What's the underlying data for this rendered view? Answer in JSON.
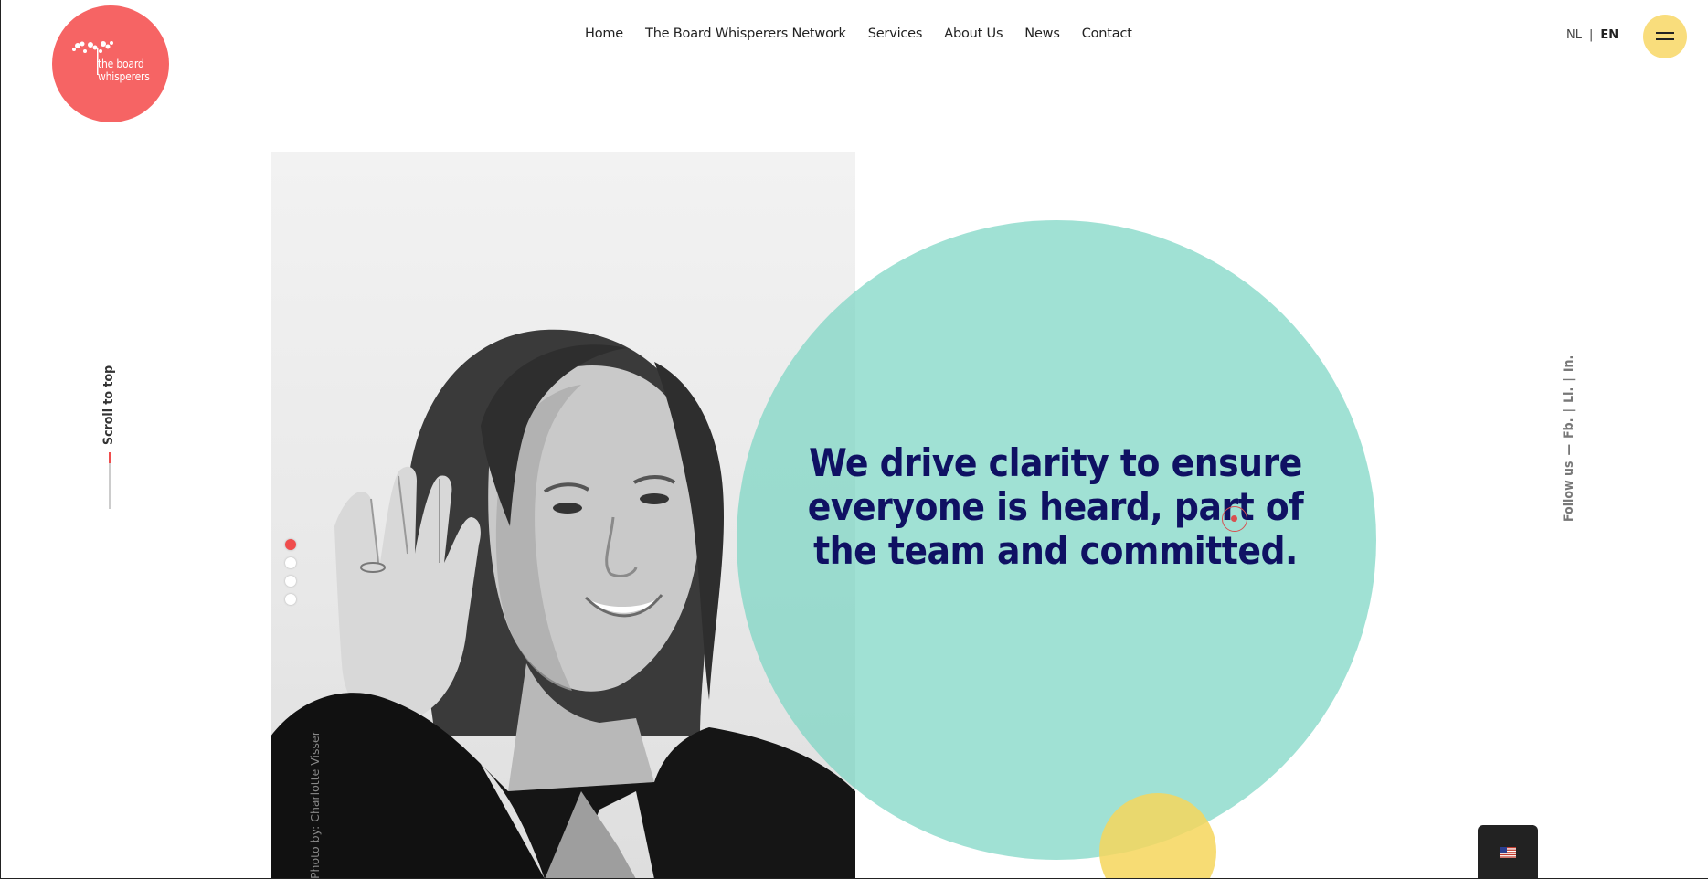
{
  "logo": {
    "line1": "the board",
    "line2": "whisperers",
    "color": "#f66464"
  },
  "nav": [
    {
      "label": "Home"
    },
    {
      "label": "The Board Whisperers Network"
    },
    {
      "label": "Services"
    },
    {
      "label": "About Us"
    },
    {
      "label": "News"
    },
    {
      "label": "Contact"
    }
  ],
  "lang": {
    "nl": "NL",
    "separator": "|",
    "en": "EN"
  },
  "menu_button": {
    "icon": "hamburger-icon",
    "color": "#f9dd7c"
  },
  "side": {
    "scroll_to_top": "Scroll to top",
    "follow_label": "Follow us",
    "follow_dash": "—",
    "links": [
      "Fb.",
      "|",
      "Li.",
      "|",
      "In."
    ]
  },
  "hero": {
    "headline": "We drive clarity to ensure everyone is heard, part of the team and committed.",
    "photo_credit": "Photo by: Charlotte Visser",
    "slides": 4,
    "active_slide": 1,
    "circle_color": "#7bd6c4",
    "headline_color": "#0f1163",
    "accent_color": "#f04d4d"
  },
  "language_widget": {
    "icon": "us-flag-icon"
  }
}
